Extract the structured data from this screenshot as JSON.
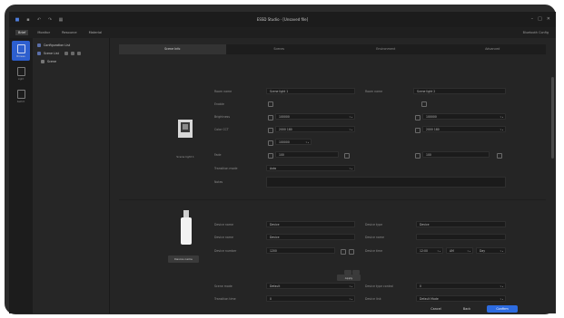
{
  "window": {
    "title": "ESSD Studio · [Unsaved file]"
  },
  "menubar": {
    "items": [
      "Brief",
      "Monitor",
      "Resource",
      "Material"
    ],
    "active_index": 0,
    "right_label": "Bluetooth Config"
  },
  "leftbar": {
    "items": [
      {
        "label": "Browse",
        "active": true
      },
      {
        "label": "Light",
        "active": false
      },
      {
        "label": "Switch",
        "active": false
      }
    ]
  },
  "tree": {
    "header": "Configuration List",
    "row1": "Scene List",
    "row2": "Scene"
  },
  "tabs": [
    "Scene Info",
    "Scenes",
    "Environment",
    "Advanced"
  ],
  "active_tab": 0,
  "section1": {
    "caption": "Scene light 1",
    "left_name_label": "Room name",
    "left_name_value": "Scene light 1",
    "right_name_label": "Room name",
    "right_name_value": "Scene light 2",
    "enable_label": "Enable",
    "brightness_label": "Brightness",
    "left_brightness": "100000",
    "right_brightness": "100000",
    "colortemp_label": "Color CCT",
    "left_cct": "2000 180",
    "right_cct": "2000 180",
    "third_row_value": "100000",
    "fade_label": "Fade",
    "left_fade": "100",
    "right_fade": "100",
    "transition_label": "Transition mode",
    "transition_value": "Auto",
    "notes_label": "Notes"
  },
  "section2": {
    "caption": "Device name",
    "label_a": "Device name",
    "value_a": "Device",
    "label_b": "Device type",
    "value_b": "Device",
    "label_c": "Device name",
    "value_c": "Device",
    "label_d": "Device name",
    "label_e": "Device number",
    "value_e": "1200",
    "label_f": "Device time",
    "value_f1": "12:00",
    "value_f2": "AM",
    "value_f3": "Day"
  },
  "section3": {
    "center_button": "Apply",
    "label_a": "Scene mode",
    "value_a": "Default",
    "label_b": "Transition time",
    "value_b": "0",
    "label_c": "Device type control",
    "value_c": "0",
    "label_d": "Device link",
    "value_d": "Default Mode"
  },
  "footer": {
    "cancel": "Cancel",
    "back": "Back",
    "confirm": "Confirm"
  }
}
